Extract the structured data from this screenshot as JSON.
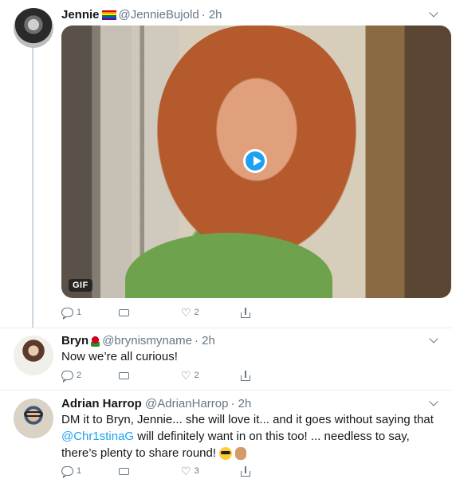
{
  "tweets": [
    {
      "name": "Jennie",
      "name_emoji": "rainbow-flag",
      "handle": "@JennieBujold",
      "time": "· 2h",
      "media_badge": "GIF",
      "reply_count": "1",
      "retweet_count": "",
      "like_count": "2"
    },
    {
      "name": "Bryn",
      "name_emoji": "rose",
      "handle": "@brynismyname",
      "time": "· 2h",
      "text": "Now we’re all curious!",
      "reply_count": "2",
      "retweet_count": "",
      "like_count": "2"
    },
    {
      "name": "Adrian Harrop",
      "handle": "@AdrianHarrop",
      "time": "· 2h",
      "text_part1": "DM it to Bryn, Jennie... she will love it... and it goes without saying that",
      "mention": "@Chr1stinaG",
      "text_part2": " will definitely want in on this too! ... needless to say, there’s plenty to share round!",
      "reply_count": "1",
      "retweet_count": "",
      "like_count": "3"
    }
  ],
  "icons": [
    "reply-icon",
    "retweet-icon",
    "like-icon",
    "share-icon",
    "chevron-down-icon",
    "play-icon"
  ],
  "colors": {
    "accent": "#1da1f2",
    "muted": "#657786",
    "divider": "#e6ecf0"
  }
}
